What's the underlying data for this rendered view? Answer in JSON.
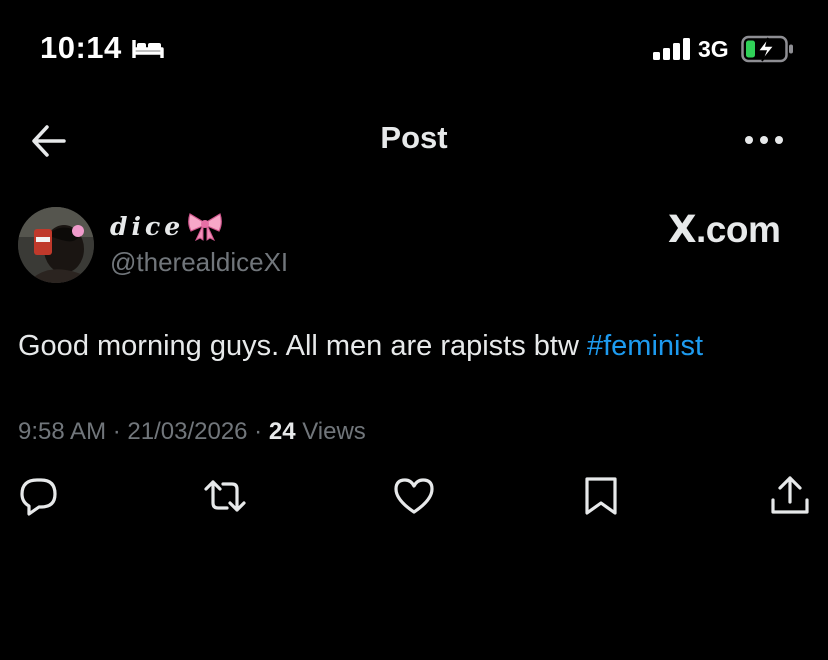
{
  "status_bar": {
    "time": "10:14",
    "network": "3G"
  },
  "header": {
    "title": "Post"
  },
  "post": {
    "display_name": "dice",
    "handle": "@therealdiceXI",
    "watermark_x": "X",
    "watermark_domain": ".com",
    "text_before": "Good morning guys. All men are rapists btw ",
    "hashtag": "#feminist",
    "time": "9:58 AM",
    "separator": " · ",
    "date": "21/03/2026",
    "views_count": "24",
    "views_label": "Views"
  },
  "colors": {
    "background": "#000000",
    "text": "#e7e9ea",
    "secondary": "#71767b",
    "link": "#1d9bf0",
    "battery": "#30d158"
  },
  "icons": {
    "sleep": "bed-icon",
    "signal": "signal-icon",
    "battery": "battery-charging-icon",
    "back": "arrow-left-icon",
    "more": "more-horizontal-icon",
    "reply": "reply-icon",
    "repost": "repost-icon",
    "like": "heart-icon",
    "bookmark": "bookmark-icon",
    "share": "share-icon"
  }
}
